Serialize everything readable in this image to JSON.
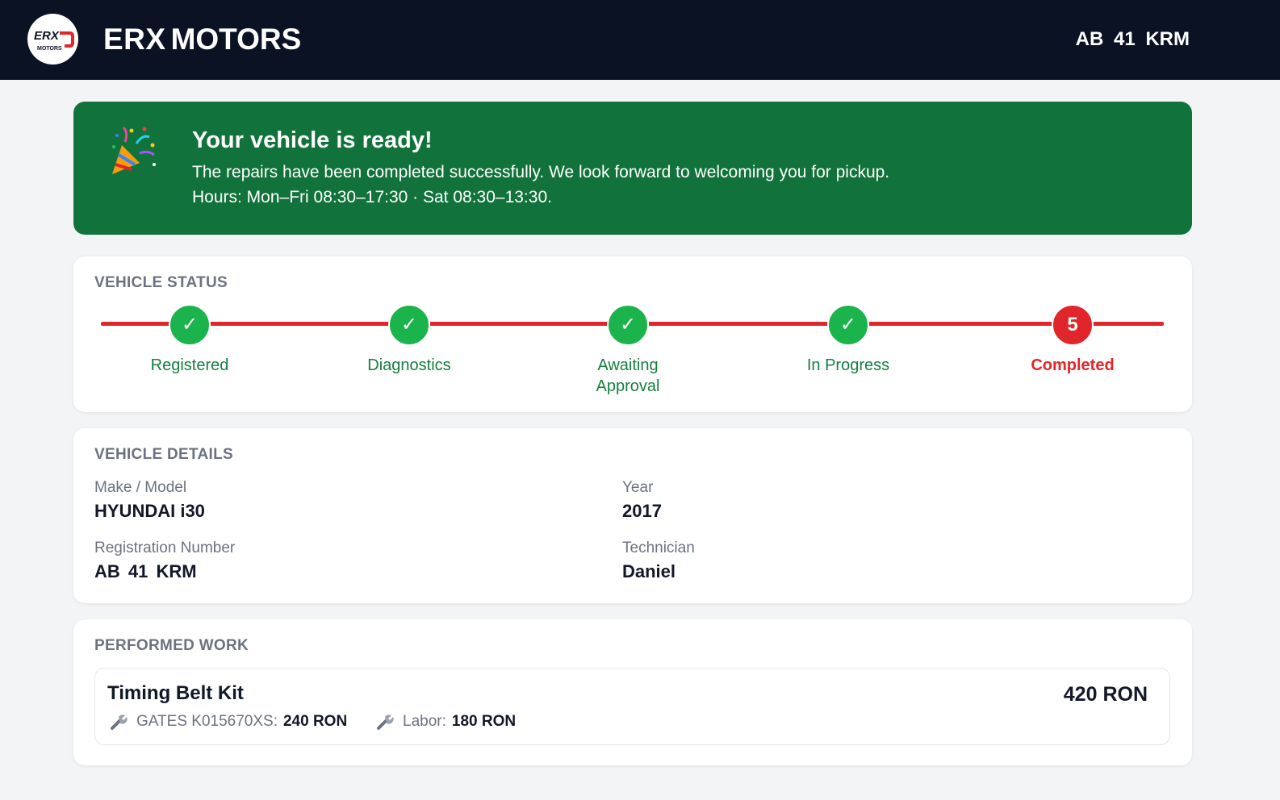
{
  "header": {
    "logo_text_top": "ERX",
    "logo_text_bottom": "MOTORS",
    "brand_primary": "ERX",
    "brand_secondary": "MOTORS",
    "plate": "AB 41 KRM"
  },
  "banner": {
    "icon": "party-popper-icon",
    "title": "Your vehicle is ready!",
    "message": "The repairs have been completed successfully. We look forward to welcoming you for pickup.",
    "hours": "Hours: Mon–Fri 08:30–17:30 · Sat 08:30–13:30."
  },
  "status": {
    "title": "VEHICLE STATUS",
    "steps": [
      {
        "label": "Registered",
        "state": "done",
        "mark": "✓"
      },
      {
        "label": "Diagnostics",
        "state": "done",
        "mark": "✓"
      },
      {
        "label": "Awaiting Approval",
        "state": "done",
        "mark": "✓"
      },
      {
        "label": "In Progress",
        "state": "done",
        "mark": "✓"
      },
      {
        "label": "Completed",
        "state": "current",
        "mark": "5"
      }
    ]
  },
  "details": {
    "title": "VEHICLE DETAILS",
    "make_model_label": "Make / Model",
    "make_model_value": "HYUNDAI i30",
    "year_label": "Year",
    "year_value": "2017",
    "registration_label": "Registration Number",
    "registration_value": "AB 41 KRM",
    "technician_label": "Technician",
    "technician_value": "Daniel"
  },
  "work": {
    "title": "PERFORMED WORK",
    "items": [
      {
        "name": "Timing Belt Kit",
        "total": "420 RON",
        "parts_label": "GATES K015670XS:",
        "parts_value": "240 RON",
        "labor_label": "Labor:",
        "labor_value": "180 RON"
      }
    ]
  },
  "colors": {
    "header_bg": "#0b1224",
    "banner_bg": "#11733b",
    "done": "#1bb44c",
    "current": "#e1262b",
    "track": "#e1262b"
  }
}
